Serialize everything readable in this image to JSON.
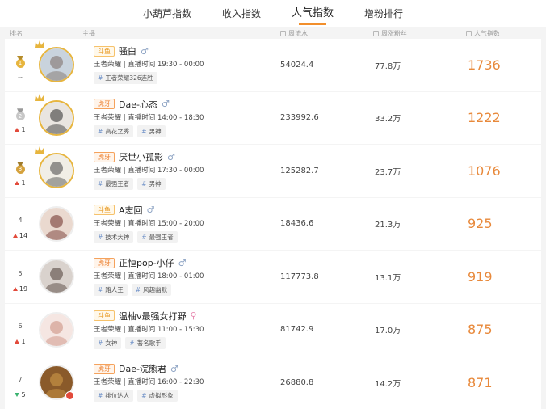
{
  "tabs": [
    {
      "label": "小葫芦指数",
      "active": false
    },
    {
      "label": "收入指数",
      "active": false
    },
    {
      "label": "人气指数",
      "active": true
    },
    {
      "label": "增粉排行",
      "active": false
    }
  ],
  "columns": {
    "rank": "排名",
    "host": "主播",
    "flow": "周流水",
    "fans": "周涨粉丝",
    "popularity": "人气指数"
  },
  "rows": [
    {
      "rank": "1",
      "medal": "gold",
      "change": "--",
      "dir": "none",
      "platform": "斗鱼",
      "platform_type": "douyu",
      "name": "骚白",
      "gender": "♂",
      "gender_type": "male",
      "meta": "王者荣耀 | 直播时间 19:30 - 00:00",
      "tags": [
        "王者荣耀326连胜"
      ],
      "flow": "54024.4",
      "fans": "77.8万",
      "popularity": "1736",
      "crown": true
    },
    {
      "rank": "2",
      "medal": "silver",
      "change": "1",
      "dir": "up",
      "platform": "虎牙",
      "platform_type": "huya",
      "name": "Dae-心态",
      "gender": "♂",
      "gender_type": "male",
      "meta": "王者荣耀 | 直播时间 14:00 - 18:30",
      "tags": [
        "高花之秀",
        "男神"
      ],
      "flow": "233992.6",
      "fans": "33.2万",
      "popularity": "1222",
      "crown": true
    },
    {
      "rank": "3",
      "medal": "bronze",
      "change": "1",
      "dir": "up",
      "platform": "虎牙",
      "platform_type": "huya",
      "name": "厌世小孤影",
      "gender": "♂",
      "gender_type": "male",
      "meta": "王者荣耀 | 直播时间 17:30 - 00:00",
      "tags": [
        "最强王者",
        "男神"
      ],
      "flow": "125282.7",
      "fans": "23.7万",
      "popularity": "1076",
      "crown": true
    },
    {
      "rank": "4",
      "medal": "",
      "change": "14",
      "dir": "up",
      "platform": "斗鱼",
      "platform_type": "douyu",
      "name": "A志回",
      "gender": "♂",
      "gender_type": "male",
      "meta": "王者荣耀 | 直播时间 15:00 - 20:00",
      "tags": [
        "技术大神",
        "最强王者"
      ],
      "flow": "18436.6",
      "fans": "21.3万",
      "popularity": "925",
      "crown": false
    },
    {
      "rank": "5",
      "medal": "",
      "change": "19",
      "dir": "up",
      "platform": "虎牙",
      "platform_type": "huya",
      "name": "正恒pop-小仔",
      "gender": "♂",
      "gender_type": "male",
      "meta": "王者荣耀 | 直播时间 18:00 - 01:00",
      "tags": [
        "路人王",
        "风趣幽默"
      ],
      "flow": "117773.8",
      "fans": "13.1万",
      "popularity": "919",
      "crown": false
    },
    {
      "rank": "6",
      "medal": "",
      "change": "1",
      "dir": "up",
      "platform": "斗鱼",
      "platform_type": "douyu",
      "name": "温柚v最强女打野",
      "gender": "♀",
      "gender_type": "female",
      "meta": "王者荣耀 | 直播时间 11:00 - 15:30",
      "tags": [
        "女神",
        "著名歌手"
      ],
      "flow": "81742.9",
      "fans": "17.0万",
      "popularity": "875",
      "crown": false
    },
    {
      "rank": "7",
      "medal": "",
      "change": "5",
      "dir": "down",
      "platform": "虎牙",
      "platform_type": "huya",
      "name": "Dae-浣熊君",
      "gender": "♂",
      "gender_type": "male",
      "meta": "王者荣耀 | 直播时间 16:00 - 22:30",
      "tags": [
        "排位达人",
        "虚拟形象"
      ],
      "flow": "26880.8",
      "fans": "14.2万",
      "popularity": "871",
      "crown": false
    }
  ],
  "colors": {
    "accent": "#e8893b",
    "up": "#e24a3b",
    "down": "#3cb371",
    "hash": "#6c8fc7"
  }
}
